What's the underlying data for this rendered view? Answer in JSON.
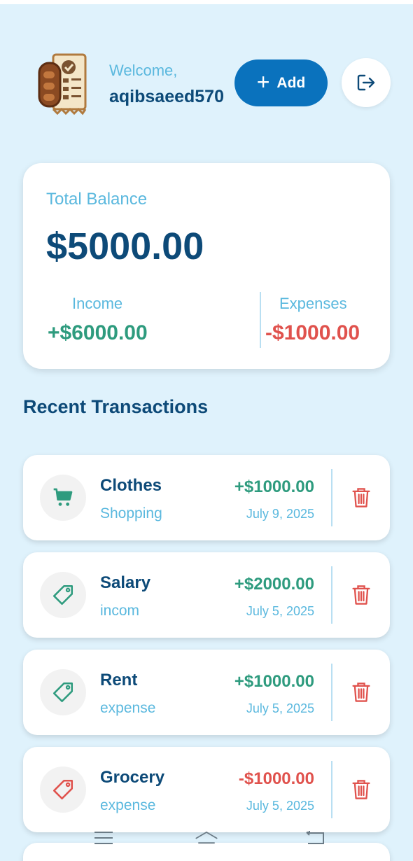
{
  "header": {
    "welcome_label": "Welcome,",
    "username": "aqibsaeed570",
    "add_label": "Add"
  },
  "balance": {
    "total_label": "Total Balance",
    "total_value": "$5000.00",
    "income_label": "Income",
    "income_value": "+$6000.00",
    "expenses_label": "Expenses",
    "expenses_value": "-$1000.00"
  },
  "transactions_title": "Recent Transactions",
  "transactions": [
    {
      "title": "Clothes",
      "category": "Shopping",
      "amount": "+$1000.00",
      "date": "July 9, 2025",
      "icon": "cart-icon",
      "sign": "positive"
    },
    {
      "title": "Salary",
      "category": "incom",
      "amount": "+$2000.00",
      "date": "July 5, 2025",
      "icon": "tag-icon",
      "sign": "positive"
    },
    {
      "title": "Rent",
      "category": "expense",
      "amount": "+$1000.00",
      "date": "July 5, 2025",
      "icon": "tag-icon",
      "sign": "positive"
    },
    {
      "title": "Grocery",
      "category": "expense",
      "amount": "-$1000.00",
      "date": "July 5, 2025",
      "icon": "tag-icon",
      "sign": "negative"
    }
  ],
  "colors": {
    "background": "#dff2fc",
    "primary": "#0a72bd",
    "dark_text": "#0d4a78",
    "light_text": "#5ab8de",
    "positive": "#2e9b7e",
    "negative": "#e0524d"
  }
}
